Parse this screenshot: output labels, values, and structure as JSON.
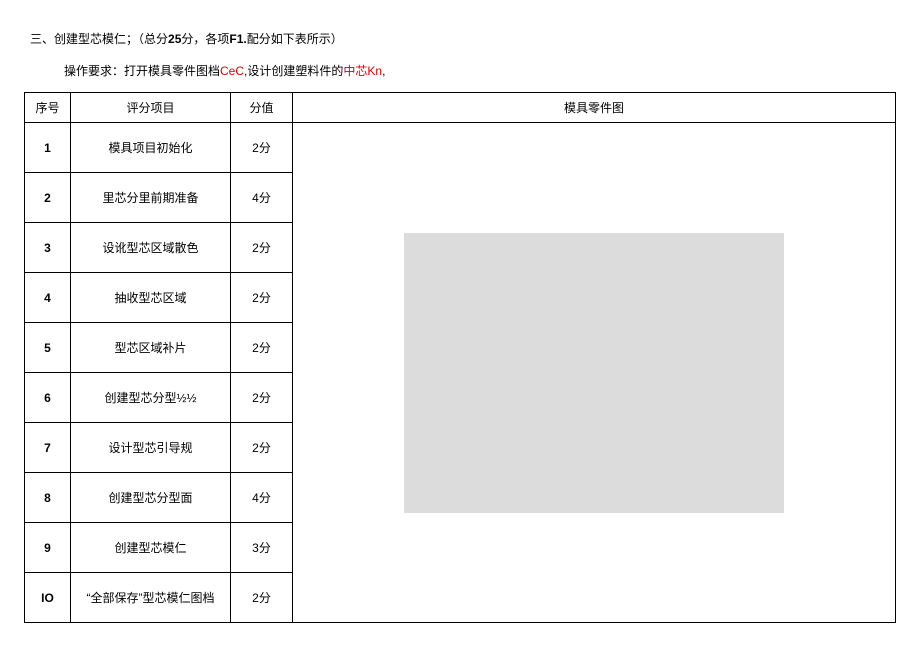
{
  "heading": {
    "prefix": "三、创建型芯模仁；（总分",
    "total_bold": "25",
    "mid": "分，各项",
    "mid_bold": "F1.",
    "suffix": "配分如下表所示）"
  },
  "subline": {
    "label": "操作要求：打开模具零件图档",
    "red1": "CeC",
    "mid": ",设计创建塑料件的",
    "red2": "中芯Kn",
    "end": ","
  },
  "columns": {
    "idx": "序号",
    "item": "评分项目",
    "score": "分值",
    "image": "模具零件图"
  },
  "rows": [
    {
      "no": "1",
      "item": "模具项目初始化",
      "score": "2分"
    },
    {
      "no": "2",
      "item": "里芯分里前期准备",
      "score": "4分"
    },
    {
      "no": "3",
      "item": "设讹型芯区域散色",
      "score": "2分"
    },
    {
      "no": "4",
      "item": "抽收型芯区域",
      "score": "2分"
    },
    {
      "no": "5",
      "item": "型芯区域补片",
      "score": "2分"
    },
    {
      "no": "6",
      "item": "创建型芯分型½½",
      "score": "2分"
    },
    {
      "no": "7",
      "item": "设计型芯引导规",
      "score": "2分"
    },
    {
      "no": "8",
      "item": "创建型芯分型面",
      "score": "4分"
    },
    {
      "no": "9",
      "item": "创建型芯模仁",
      "score": "3分"
    },
    {
      "no": "IO",
      "item": "“全部保存”型芯模仁图档",
      "score": "2分"
    }
  ]
}
